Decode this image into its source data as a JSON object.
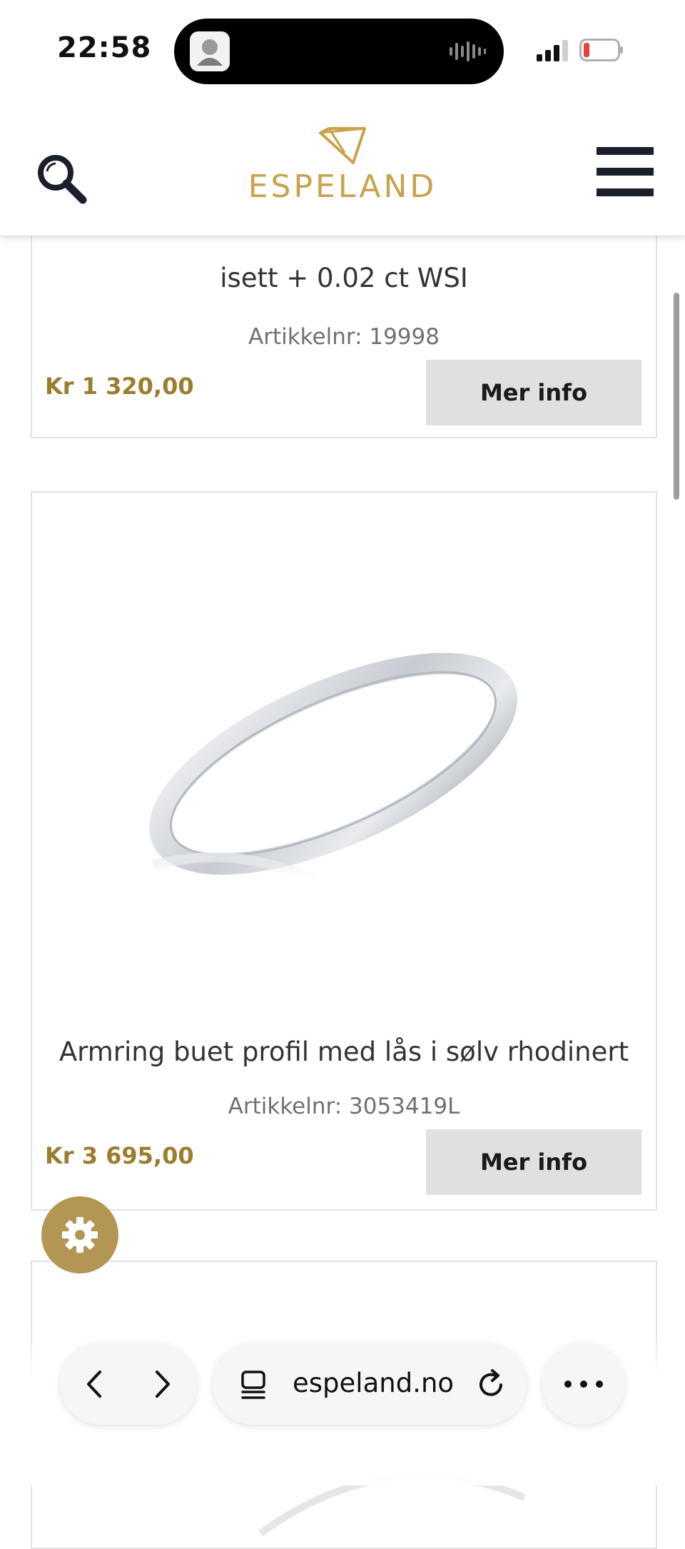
{
  "status_bar": {
    "time": "22:58"
  },
  "header": {
    "logo_text": "ESPELAND",
    "brand_color": "#c9a24b"
  },
  "products": [
    {
      "title": "isett + 0.02 ct WSI",
      "sku": "Artikkelnr: 19998",
      "price": "Kr 1 320,00",
      "button_label": "Mer info"
    },
    {
      "title": "Armring buet profil med lås i sølv rhodinert",
      "sku": "Artikkelnr: 3053419L",
      "price": "Kr 3 695,00",
      "button_label": "Mer info"
    }
  ],
  "colors": {
    "price": "#9a7d2e",
    "button_bg": "#e0e0e0",
    "gear_bg": "#b39654"
  },
  "browser": {
    "url": "espeland.no"
  }
}
